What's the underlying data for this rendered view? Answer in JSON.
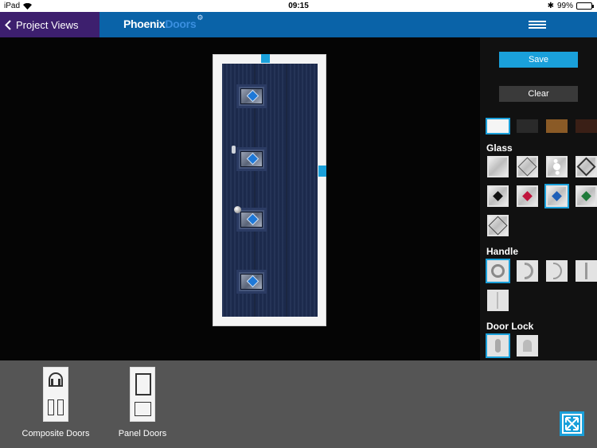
{
  "status_bar": {
    "device": "iPad",
    "time": "09:15",
    "battery": "99%",
    "battery_level": 0.99
  },
  "nav": {
    "back_label": "Project Views",
    "brand_primary": "Phoenix",
    "brand_secondary": "Doors"
  },
  "actions": {
    "save_label": "Save",
    "clear_label": "Clear"
  },
  "colors": [
    "#f5f5f5",
    "#2a2a2a",
    "#8a5a26",
    "#3a1f16"
  ],
  "sections": {
    "glass": "Glass",
    "handle": "Handle",
    "door_lock": "Door Lock"
  },
  "glass_options": [
    {
      "name": "plain"
    },
    {
      "name": "diamond-clear"
    },
    {
      "name": "bubble"
    },
    {
      "name": "diamond-frame"
    },
    {
      "name": "black-diamond"
    },
    {
      "name": "red-diamond"
    },
    {
      "name": "blue-diamond",
      "selected": true
    },
    {
      "name": "green-diamond"
    },
    {
      "name": "leaded"
    }
  ],
  "handle_options": [
    "round-handle",
    "d-handle",
    "curved-handle",
    "bar-handle",
    "flush-handle"
  ],
  "lock_options": [
    "oval-lock",
    "keyhole-lock"
  ],
  "door_types": [
    {
      "label": "Composite Doors"
    },
    {
      "label": "Panel Doors"
    }
  ],
  "accent": "#1aa0da",
  "door_color": "#1e2d52"
}
